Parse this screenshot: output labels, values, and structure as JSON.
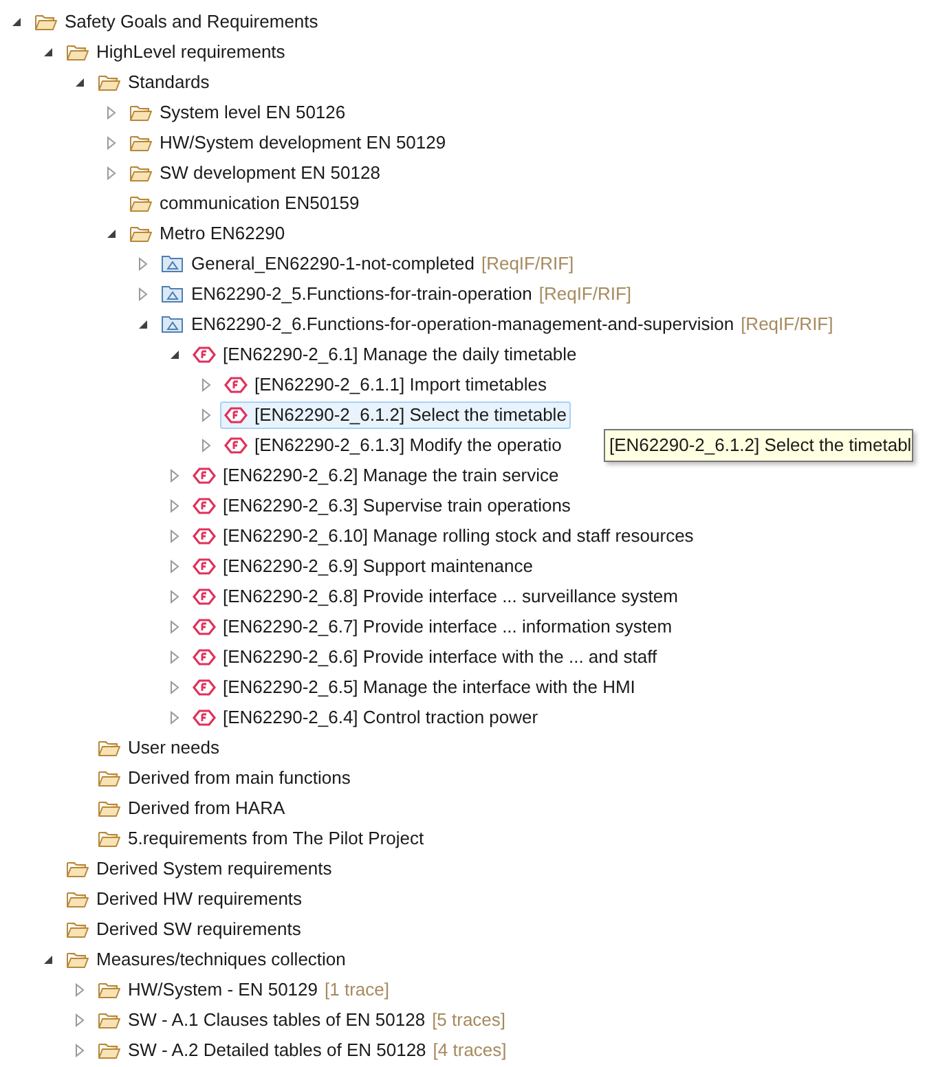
{
  "tree": [
    {
      "label": "Safety Goals and Requirements",
      "kind": "folder",
      "expanded": true,
      "selected": false,
      "children": [
        {
          "label": "HighLevel requirements",
          "kind": "folder",
          "expanded": true,
          "selected": false,
          "children": [
            {
              "label": "Standards",
              "kind": "folder",
              "expanded": true,
              "selected": false,
              "children": [
                {
                  "label": "System level EN 50126",
                  "kind": "folder",
                  "expanded": false,
                  "selected": false
                },
                {
                  "label": "HW/System development EN 50129",
                  "kind": "folder",
                  "expanded": false,
                  "selected": false
                },
                {
                  "label": "SW development EN 50128",
                  "kind": "folder",
                  "expanded": false,
                  "selected": false
                },
                {
                  "label": "communication EN50159",
                  "kind": "folder",
                  "selected": false
                },
                {
                  "label": "Metro EN62290",
                  "kind": "folder",
                  "expanded": true,
                  "selected": false,
                  "children": [
                    {
                      "label": "General_EN62290-1-not-completed",
                      "annotation": "[ReqIF/RIF]",
                      "kind": "model",
                      "expanded": false,
                      "selected": false
                    },
                    {
                      "label": "EN62290-2_5.Functions-for-train-operation",
                      "annotation": "[ReqIF/RIF]",
                      "kind": "model",
                      "expanded": false,
                      "selected": false
                    },
                    {
                      "label": "EN62290-2_6.Functions-for-operation-management-and-supervision",
                      "annotation": "[ReqIF/RIF]",
                      "kind": "model",
                      "expanded": true,
                      "selected": false,
                      "children": [
                        {
                          "label": "[EN62290-2_6.1] Manage the daily timetable",
                          "kind": "requirement",
                          "expanded": true,
                          "selected": false,
                          "children": [
                            {
                              "label": "[EN62290-2_6.1.1] Import timetables",
                              "kind": "requirement",
                              "expanded": false,
                              "selected": false
                            },
                            {
                              "label": "[EN62290-2_6.1.2] Select the timetable",
                              "kind": "requirement",
                              "expanded": false,
                              "selected": true
                            },
                            {
                              "label": "[EN62290-2_6.1.3] Modify the operatio",
                              "kind": "requirement",
                              "expanded": false,
                              "selected": false
                            }
                          ]
                        },
                        {
                          "label": "[EN62290-2_6.2] Manage the train service",
                          "kind": "requirement",
                          "expanded": false,
                          "selected": false
                        },
                        {
                          "label": "[EN62290-2_6.3] Supervise train operations",
                          "kind": "requirement",
                          "expanded": false,
                          "selected": false
                        },
                        {
                          "label": "[EN62290-2_6.10] Manage rolling stock and staff resources",
                          "kind": "requirement",
                          "expanded": false,
                          "selected": false
                        },
                        {
                          "label": "[EN62290-2_6.9] Support maintenance",
                          "kind": "requirement",
                          "expanded": false,
                          "selected": false
                        },
                        {
                          "label": "[EN62290-2_6.8] Provide interface ... surveillance system",
                          "kind": "requirement",
                          "expanded": false,
                          "selected": false
                        },
                        {
                          "label": "[EN62290-2_6.7] Provide interface ... information system",
                          "kind": "requirement",
                          "expanded": false,
                          "selected": false
                        },
                        {
                          "label": "[EN62290-2_6.6] Provide interface with the ... and staff",
                          "kind": "requirement",
                          "expanded": false,
                          "selected": false
                        },
                        {
                          "label": "[EN62290-2_6.5] Manage the interface with the HMI",
                          "kind": "requirement",
                          "expanded": false,
                          "selected": false
                        },
                        {
                          "label": "[EN62290-2_6.4] Control traction power",
                          "kind": "requirement",
                          "expanded": false,
                          "selected": false
                        }
                      ]
                    }
                  ]
                }
              ]
            },
            {
              "label": "User needs",
              "kind": "folder",
              "selected": false
            },
            {
              "label": "Derived from main functions",
              "kind": "folder",
              "selected": false
            },
            {
              "label": "Derived from HARA",
              "kind": "folder",
              "selected": false
            },
            {
              "label": "5.requirements from The Pilot Project",
              "kind": "folder",
              "selected": false
            }
          ]
        },
        {
          "label": "Derived System requirements",
          "kind": "folder",
          "selected": false
        },
        {
          "label": "Derived HW requirements",
          "kind": "folder",
          "selected": false
        },
        {
          "label": "Derived SW requirements",
          "kind": "folder",
          "selected": false
        },
        {
          "label": "Measures/techniques collection",
          "kind": "folder",
          "expanded": true,
          "selected": false,
          "children": [
            {
              "label": "HW/System - EN 50129",
              "annotation": "[1 trace]",
              "kind": "folder",
              "expanded": false,
              "selected": false
            },
            {
              "label": "SW - A.1 Clauses tables of EN 50128",
              "annotation": "[5 traces]",
              "kind": "folder",
              "expanded": false,
              "selected": false
            },
            {
              "label": "SW - A.2 Detailed tables of EN 50128",
              "annotation": "[4 traces]",
              "kind": "folder",
              "expanded": false,
              "selected": false
            }
          ]
        }
      ]
    }
  ],
  "tooltip": {
    "text": "[EN62290-2_6.1.2] Select the timetabl"
  }
}
